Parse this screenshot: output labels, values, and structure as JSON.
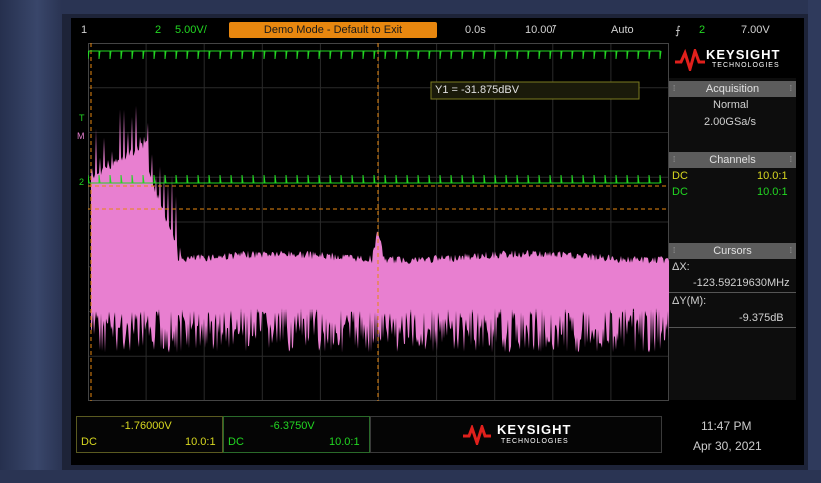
{
  "topbar": {
    "ch1_num": "1",
    "ch2_num": "2",
    "ch2_scale": "5.00V/",
    "mode_banner": "Demo Mode - Default to Exit",
    "delay": "0.0s",
    "timebase": "10.00̃/",
    "trigger_mode": "Auto",
    "trigger_icon": "⨍",
    "trigger_channel": "2",
    "trigger_level": "7.00V"
  },
  "plot": {
    "cursor_readout": "Y1 = -31.875dBV",
    "marker_t": "T",
    "marker_m": "M",
    "marker_2": "2"
  },
  "panel": {
    "brand": "KEYSIGHT",
    "brand_sub": "TECHNOLOGIES",
    "acquisition": {
      "title": "Acquisition",
      "mode": "Normal",
      "rate": "2.00GSa/s"
    },
    "channels": {
      "title": "Channels",
      "ch1_coupling": "DC",
      "ch1_ratio": "10.0:1",
      "ch2_coupling": "DC",
      "ch2_ratio": "10.0:1"
    },
    "cursors": {
      "title": "Cursors",
      "dx_label": "ΔX:",
      "dx_value": "-123.59219630MHz",
      "dy_label": "ΔY(M):",
      "dy_value": "-9.375dB"
    }
  },
  "bottom": {
    "ch1": {
      "value": "-1.76000V",
      "coupling": "DC",
      "ratio": "10.0:1"
    },
    "ch2": {
      "value": "-6.3750V",
      "coupling": "DC",
      "ratio": "10.0:1"
    },
    "brand": "KEYSIGHT",
    "brand_sub": "TECHNOLOGIES",
    "time": "11:47 PM",
    "date": "Apr 30, 2021"
  },
  "colors": {
    "ch1": "#d8d820",
    "ch2": "#22d622",
    "math": "#e87fd0",
    "cursor": "#e8870f",
    "banner": "#e8870f"
  }
}
